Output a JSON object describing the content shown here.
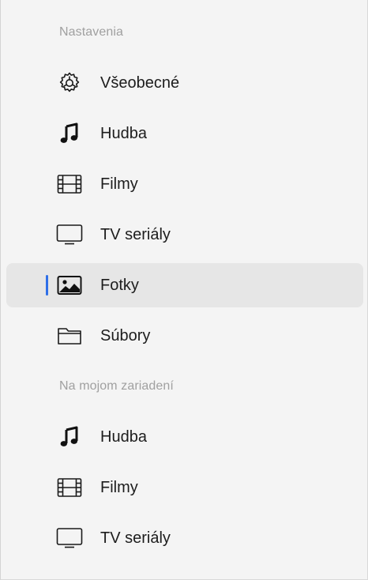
{
  "sections": [
    {
      "header": "Nastavenia",
      "items": [
        {
          "label": "Všeobecné",
          "icon": "gear-icon"
        },
        {
          "label": "Hudba",
          "icon": "music-note-icon"
        },
        {
          "label": "Filmy",
          "icon": "film-icon"
        },
        {
          "label": "TV seriály",
          "icon": "tv-icon"
        },
        {
          "label": "Fotky",
          "icon": "photo-icon",
          "selected": true
        },
        {
          "label": "Súbory",
          "icon": "folder-icon"
        }
      ]
    },
    {
      "header": "Na mojom zariadení",
      "items": [
        {
          "label": "Hudba",
          "icon": "music-note-icon"
        },
        {
          "label": "Filmy",
          "icon": "film-icon"
        },
        {
          "label": "TV seriály",
          "icon": "tv-icon"
        }
      ]
    }
  ],
  "colors": {
    "selection_indicator": "#2e6fe8",
    "selected_background": "#e6e6e6",
    "header_text": "#a0a0a0"
  }
}
